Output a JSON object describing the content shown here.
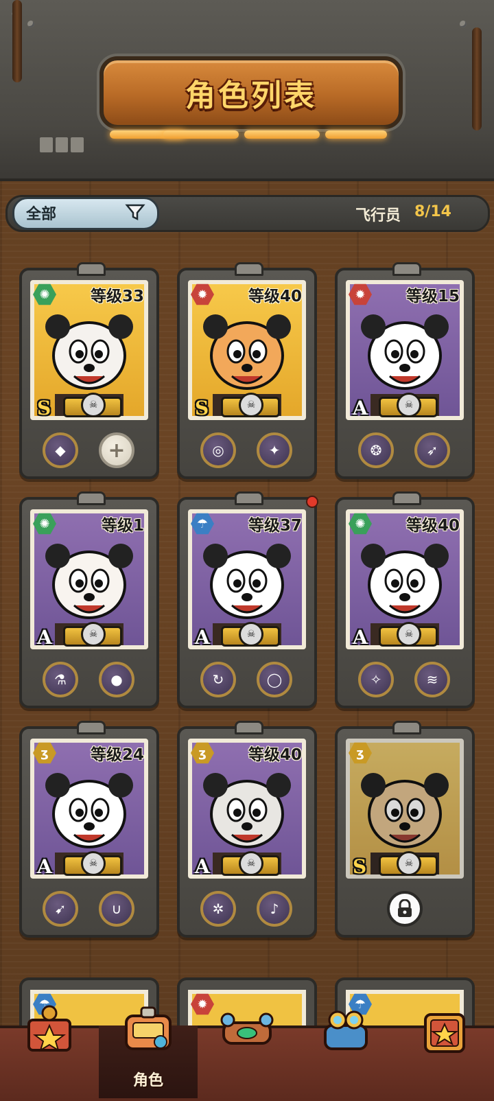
{
  "header": {
    "title": "角色列表"
  },
  "filter": {
    "label": "全部",
    "icon": "filter-funnel-icon"
  },
  "pilots": {
    "label": "飞行员",
    "count": "8/14"
  },
  "cards": [
    {
      "element": "wind-icon",
      "element_glyph": "✺",
      "level": "等级33",
      "rank": "S",
      "bg": "gold",
      "equip": [
        "crystal-icon",
        "add-icon"
      ],
      "equip_glyph": [
        "◆",
        "+"
      ]
    },
    {
      "element": "fire-icon",
      "element_glyph": "✹",
      "level": "等级40",
      "rank": "S",
      "bg": "gold",
      "equip": [
        "saturn-icon",
        "beetle-icon"
      ],
      "equip_glyph": [
        "◎",
        "✦"
      ]
    },
    {
      "element": "fire-icon",
      "element_glyph": "✹",
      "level": "等级15",
      "rank": "A",
      "bg": "purple",
      "equip": [
        "wing-badge-icon",
        "rocket-icon"
      ],
      "equip_glyph": [
        "❂",
        "➶"
      ]
    },
    {
      "element": "wind-icon",
      "element_glyph": "✺",
      "level": "等级1",
      "rank": "A",
      "bg": "purple",
      "equip": [
        "bottle-icon",
        "orb-icon"
      ],
      "equip_glyph": [
        "⚗",
        "●"
      ]
    },
    {
      "element": "water-icon",
      "element_glyph": "☂",
      "level": "等级37",
      "rank": "A",
      "bg": "purple",
      "equip": [
        "cycle-icon",
        "ring-icon"
      ],
      "equip_glyph": [
        "↻",
        "◯"
      ]
    },
    {
      "element": "wind-icon",
      "element_glyph": "✺",
      "level": "等级40",
      "rank": "A",
      "bg": "purple",
      "equip": [
        "gem-icon",
        "coil-icon"
      ],
      "equip_glyph": [
        "✧",
        "≋"
      ]
    },
    {
      "element": "gold-icon",
      "element_glyph": "ʒ",
      "level": "等级24",
      "rank": "A",
      "bg": "purple",
      "equip": [
        "missile-icon",
        "magnet-icon"
      ],
      "equip_glyph": [
        "➹",
        "∪"
      ]
    },
    {
      "element": "gold-icon",
      "element_glyph": "ʒ",
      "level": "等级40",
      "rank": "A",
      "bg": "purple",
      "equip": [
        "whirl-icon",
        "horn-icon"
      ],
      "equip_glyph": [
        "✲",
        "♪"
      ]
    },
    {
      "element": "gold-icon",
      "element_glyph": "ʒ",
      "level": "",
      "rank": "S",
      "bg": "gold",
      "locked": true,
      "equip": [
        "lock-icon"
      ],
      "equip_glyph": [
        "🔒"
      ]
    }
  ],
  "nav": [
    {
      "id": "nav-shop",
      "label": "",
      "icon": "treasure-box-icon"
    },
    {
      "id": "nav-roles",
      "label": "角色",
      "icon": "character-bag-icon"
    },
    {
      "id": "nav-plane",
      "label": "",
      "icon": "plane-console-icon"
    },
    {
      "id": "nav-pilot",
      "label": "",
      "icon": "goggles-helmet-icon"
    },
    {
      "id": "nav-collection",
      "label": "",
      "icon": "star-book-icon"
    }
  ],
  "colors": {
    "accent_gold": "#f3c54a",
    "wood": "#5e3d20",
    "metal": "#4a4843"
  }
}
